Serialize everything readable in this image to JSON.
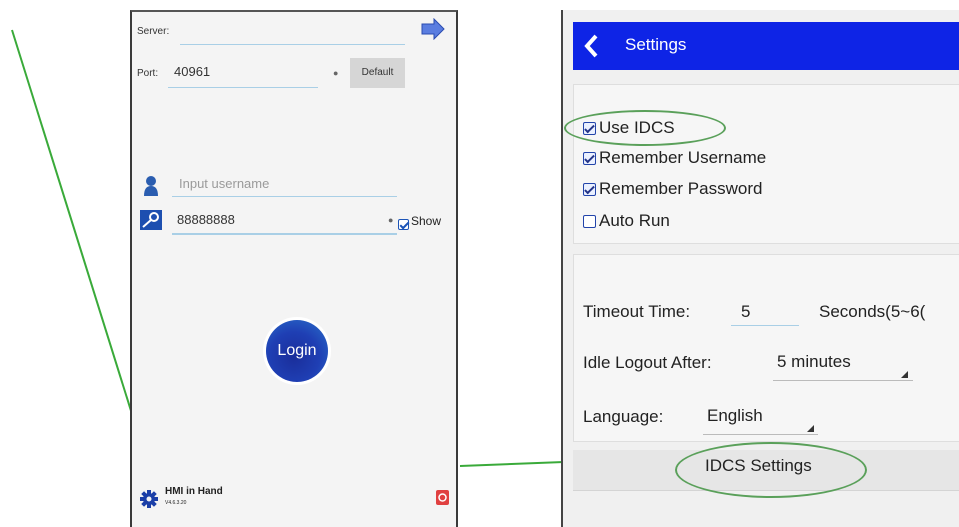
{
  "login": {
    "server_label": "Server:",
    "port_label": "Port:",
    "port_value": "40961",
    "default_label": "Default",
    "username_placeholder": "Input username",
    "password_value": "88888888",
    "show_label": "Show",
    "login_label": "Login",
    "app_name": "HMI in Hand",
    "app_version": "V4.6.3.20"
  },
  "settings": {
    "title": "Settings",
    "options": {
      "use_idcs": "Use IDCS",
      "remember_username": "Remember Username",
      "remember_password": "Remember Password",
      "auto_run": "Auto Run"
    },
    "timeout_label": "Timeout Time:",
    "timeout_value": "5",
    "timeout_unit": "Seconds(5~6(",
    "idle_label": "Idle Logout After:",
    "idle_value": "5 minutes",
    "language_label": "Language:",
    "language_value": "English",
    "idcs_settings_label": "IDCS Settings"
  },
  "colors": {
    "header": "#0e24e6",
    "arrow": "#3aaa3a",
    "highlight_ring": "#5aa05a",
    "login_button": "#1f3fb4"
  }
}
